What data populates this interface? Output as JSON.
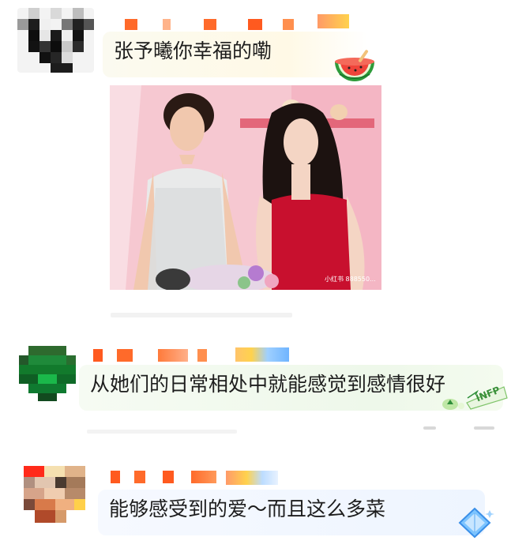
{
  "comments": [
    {
      "text": "张予曦你幸福的嘞",
      "has_image": true,
      "decoration_icon": "watermelon-icon",
      "image_watermark": "小红书 888550..."
    },
    {
      "text": "从她们的日常相处中就能感觉到感情很好",
      "decoration_icon": "infp-badge-icon",
      "decoration_text": "INFP"
    },
    {
      "text": "能够感受到的爱～而且这么多菜",
      "decoration_icon": "blue-diamond-icon"
    }
  ],
  "colors": {
    "name_redact_orange": "#ff5a1f",
    "name_redact_yellow": "#ffd24d",
    "name_redact_blue": "#8cc4ff",
    "photo_background_pink": "#f6c6cf",
    "dress_red": "#c8102e"
  }
}
